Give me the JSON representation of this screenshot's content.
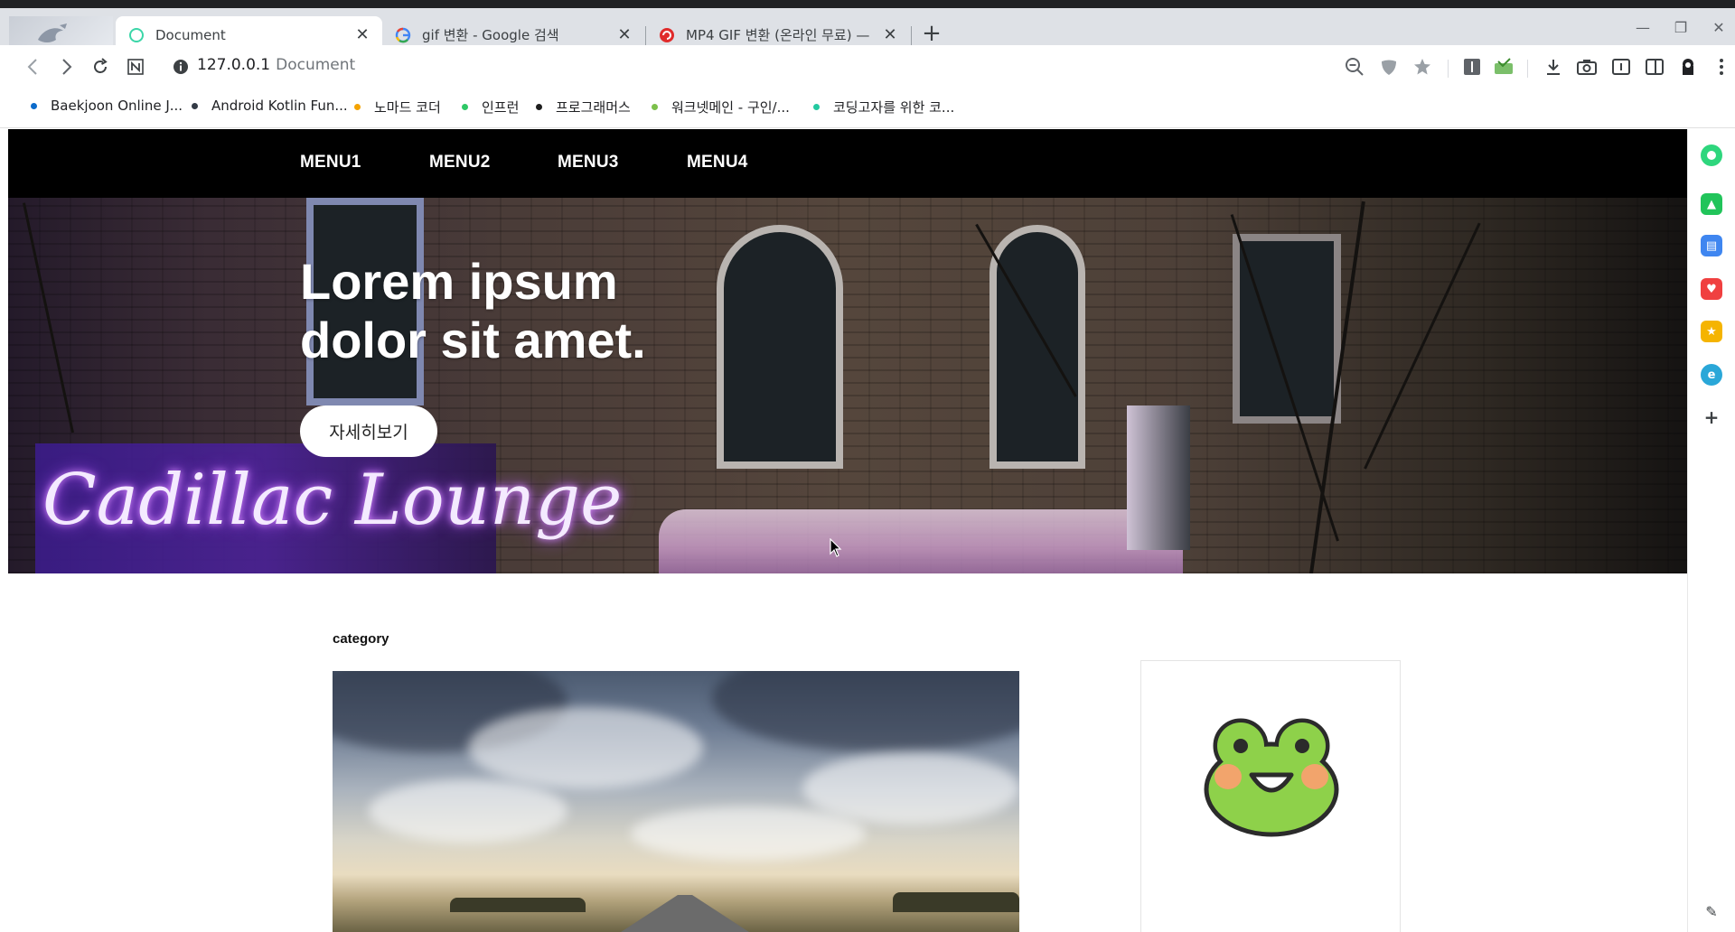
{
  "browser": {
    "tabs": [
      {
        "title": "Document",
        "active": true
      },
      {
        "title": "gif 변환 - Google 검색",
        "active": false
      },
      {
        "title": "MP4 GIF 변환 (온라인 무료) — ",
        "active": false
      }
    ],
    "address": {
      "host": "127.0.0.1",
      "page_title": "Document"
    },
    "bookmarks": [
      {
        "label": "Baekjoon Online J...",
        "color": "#0b6bcb"
      },
      {
        "label": "Android Kotlin Fun...",
        "color": "#333b46"
      },
      {
        "label": "노마드 코더",
        "color": "#f4a300"
      },
      {
        "label": "인프런",
        "color": "#2ec866"
      },
      {
        "label": "프로그래머스",
        "color": "#1e1e1e"
      },
      {
        "label": "워크넷메인 - 구인/...",
        "color": "#7cc04b"
      },
      {
        "label": "코딩고자를 위한 코...",
        "color": "#23c9a0"
      }
    ]
  },
  "site": {
    "menu": [
      "MENU1",
      "MENU2",
      "MENU3",
      "MENU4"
    ],
    "hero": {
      "title_line1": "Lorem ipsum",
      "title_line2": "dolor sit amet.",
      "button": "자세히보기",
      "neon_sign": "Cadillac Lounge"
    },
    "category_label": "category"
  },
  "colors": {
    "nav_bg": "#000000",
    "tab_strip": "#dee1e6",
    "frog_green": "#8ed14a"
  }
}
